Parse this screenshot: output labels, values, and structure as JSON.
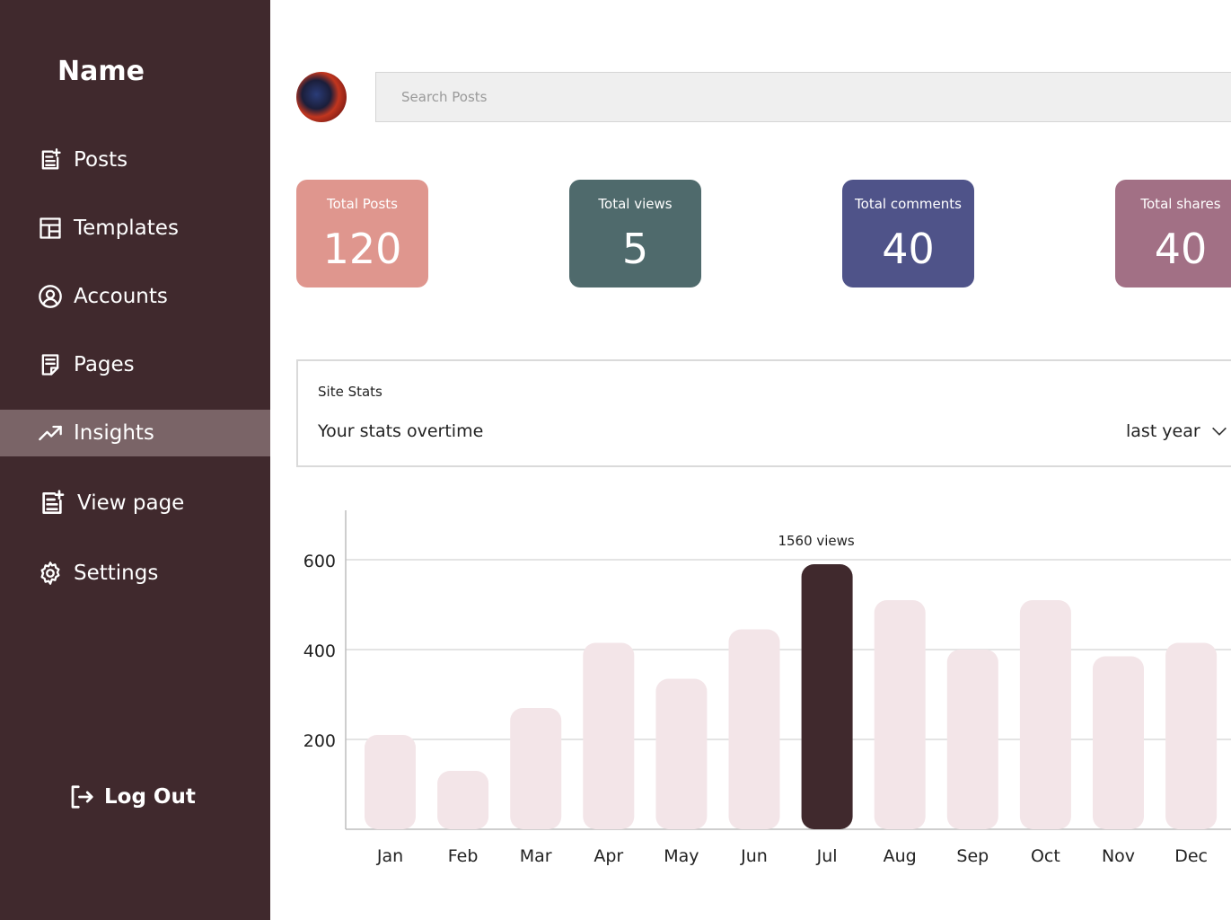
{
  "sidebar": {
    "brand": "Name",
    "items": [
      {
        "label": "Posts",
        "icon": "post-add-icon"
      },
      {
        "label": "Templates",
        "icon": "templates-icon"
      },
      {
        "label": "Accounts",
        "icon": "account-icon"
      },
      {
        "label": "Pages",
        "icon": "pages-icon"
      },
      {
        "label": "Insights",
        "icon": "trending-up-icon",
        "active": true
      },
      {
        "label": "View page",
        "icon": "post-add-icon"
      },
      {
        "label": "Settings",
        "icon": "gear-icon"
      }
    ],
    "logout_label": "Log Out"
  },
  "header": {
    "search_placeholder": "Search Posts"
  },
  "cards": [
    {
      "label": "Total Posts",
      "value": "120",
      "color": "#DF968E"
    },
    {
      "label": "Total views",
      "value": "5",
      "color": "#4F6A6C"
    },
    {
      "label": "Total comments",
      "value": "40",
      "color": "#4F5389"
    },
    {
      "label": "Total shares",
      "value": "40",
      "color": "#A27085"
    }
  ],
  "site_stats": {
    "title": "Site Stats",
    "subtitle": "Your stats overtime",
    "period": "last year"
  },
  "colors": {
    "sidebar_bg": "#40292D",
    "active_item": "#7A6467",
    "bar": "#F3E5E8",
    "bar_highlight": "#40292D"
  },
  "chart_data": {
    "type": "bar",
    "categories": [
      "Jan",
      "Feb",
      "Mar",
      "Apr",
      "May",
      "Jun",
      "Jul",
      "Aug",
      "Sep",
      "Oct",
      "Nov",
      "Dec"
    ],
    "values": [
      210,
      130,
      270,
      415,
      335,
      445,
      590,
      510,
      400,
      510,
      385,
      415
    ],
    "highlight_index": 6,
    "highlight_label": "1560 views",
    "yticks": [
      200,
      400,
      600
    ],
    "ylim": [
      0,
      600
    ],
    "grid": true
  }
}
